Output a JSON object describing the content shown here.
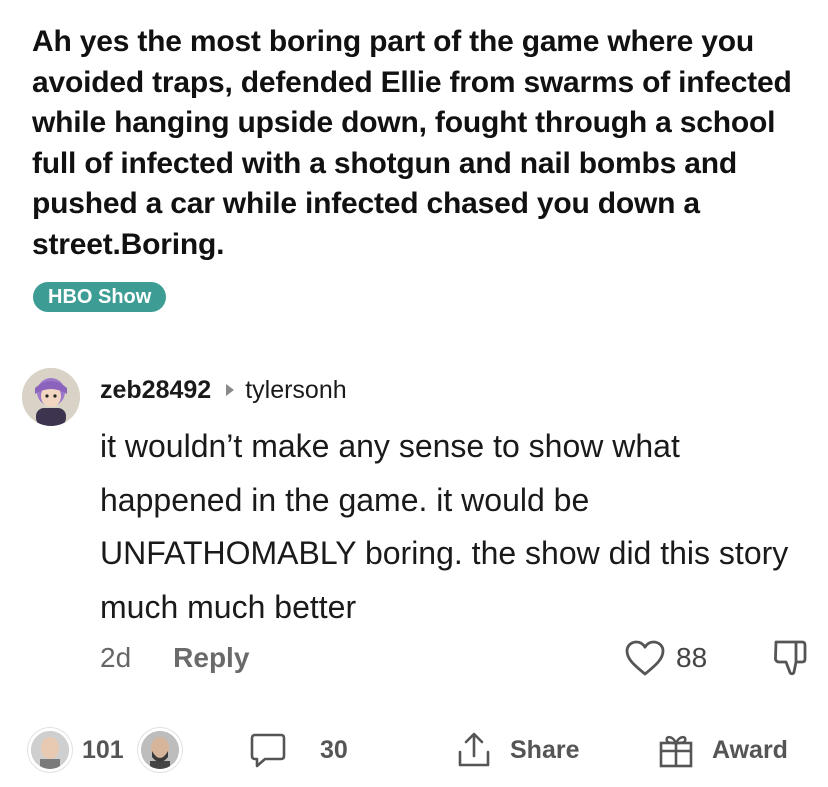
{
  "post": {
    "body": "Ah yes the most boring part of the game where you avoided traps, defended Ellie from swarms of infected while hanging upside down, fought through a school full of infected with a shotgun and nail bombs and pushed a car while infected chased you down a street.Boring.",
    "flair": "HBO Show"
  },
  "comment": {
    "author": "zeb28492",
    "reply_to": "tylersonh",
    "text": "it wouldn’t make any sense to show what happened in the game. it would be UNFATHOMABLY boring. the show did this story much much better",
    "age": "2d",
    "reply_label": "Reply",
    "likes": "88"
  },
  "footer": {
    "upvotes": "101",
    "comments": "30",
    "share_label": "Share",
    "award_label": "Award"
  },
  "colors": {
    "flair_bg": "#3d9c93",
    "text_primary": "#111111",
    "text_muted": "#666666"
  },
  "icons": {
    "heart": "heart-icon",
    "dislike": "thumbs-down-icon",
    "comment": "comment-bubble-icon",
    "share": "share-icon",
    "award": "gift-icon"
  }
}
